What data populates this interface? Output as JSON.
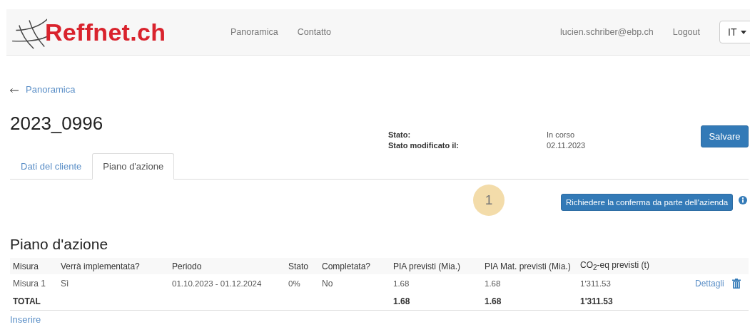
{
  "brand": {
    "name": "Reffnet.ch"
  },
  "nav": {
    "links": [
      "Panoramica",
      "Contatto"
    ],
    "user": "lucien.schriber@ebp.ch",
    "logout": "Logout",
    "language": "IT"
  },
  "back_link": "Panoramica",
  "title": "2023_0996",
  "status": [
    {
      "label": "Stato:",
      "value": "In corso"
    },
    {
      "label": "Stato modificato il:",
      "value": "02.11.2023"
    }
  ],
  "save_button": "Salvare",
  "tabs": [
    {
      "label": "Dati del cliente",
      "selected": false
    },
    {
      "label": "Piano d'azione",
      "selected": true
    }
  ],
  "step_badge": "1",
  "request_button": "Richiedere la conferma da parte dell'azienda",
  "section_title": "Piano d'azione",
  "table": {
    "columns": [
      "Misura",
      "Verrà implementata?",
      "Periodo",
      "Stato",
      "Completata?",
      "PIA previsti (Mia.)",
      "PIA Mat. previsti (Mia.)",
      "CO$_{2}$-eq previsti (t)"
    ],
    "rows": [
      {
        "cells": [
          "Misura 1",
          "Sì",
          "01.10.2023 - 01.12.2024",
          "0%",
          "No",
          "1.68",
          "1.68",
          "1'311.53"
        ],
        "link": "Dettagli"
      }
    ],
    "total": {
      "label": "TOTAL",
      "values": [
        "1.68",
        "1.68",
        "1'311.53"
      ]
    }
  },
  "add_link": "Inserire"
}
